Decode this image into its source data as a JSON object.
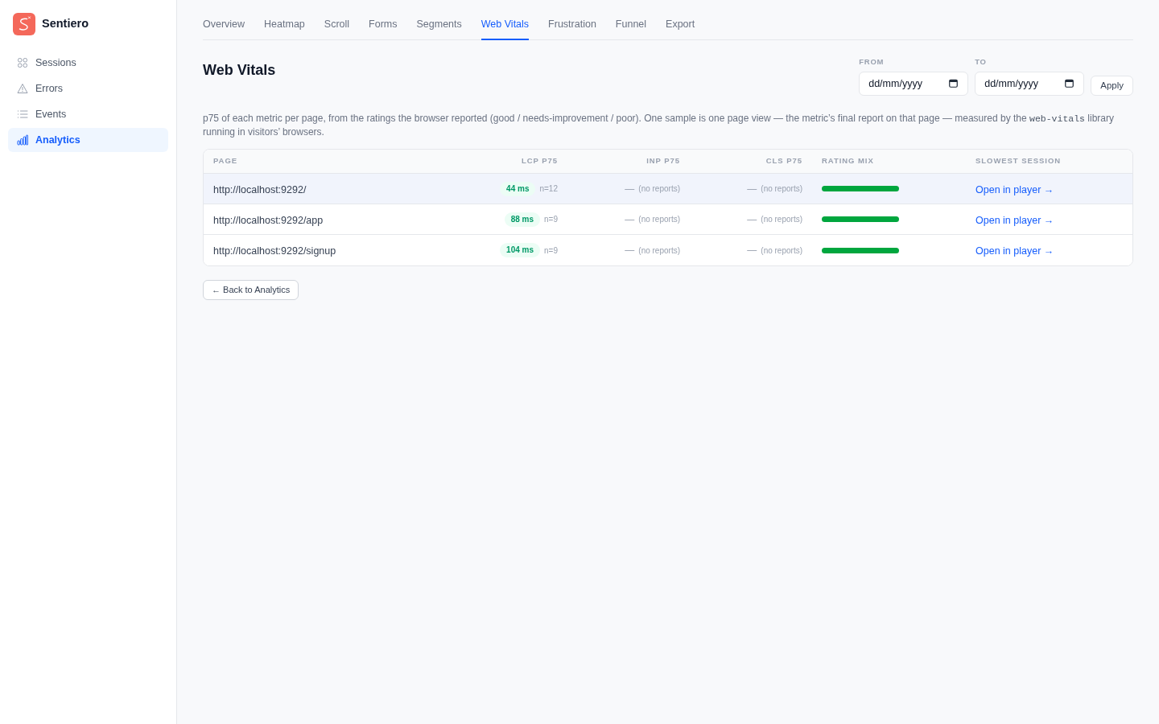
{
  "sidebar": {
    "brand": "Sentiero",
    "items": [
      {
        "label": "Sessions",
        "selected": false
      },
      {
        "label": "Errors",
        "selected": false
      },
      {
        "label": "Events",
        "selected": false
      },
      {
        "label": "Analytics",
        "selected": true
      }
    ]
  },
  "tabs": [
    {
      "label": "Overview",
      "selected": false
    },
    {
      "label": "Heatmap",
      "selected": false
    },
    {
      "label": "Scroll",
      "selected": false
    },
    {
      "label": "Forms",
      "selected": false
    },
    {
      "label": "Segments",
      "selected": false
    },
    {
      "label": "Web Vitals",
      "selected": true
    },
    {
      "label": "Frustration",
      "selected": false
    },
    {
      "label": "Funnel",
      "selected": false
    },
    {
      "label": "Export",
      "selected": false
    }
  ],
  "page": {
    "title": "Web Vitals",
    "filters": [
      {
        "label": "FROM",
        "placeholder": "dd/mm/yyyy"
      },
      {
        "label": "TO",
        "placeholder": "dd/mm/yyyy"
      }
    ],
    "apply_button": "Apply",
    "description": [
      {
        "kind": "text",
        "text": "p75 of each metric per page, from the ratings the browser reported (good / needs-improvement / poor). One sample is one page view — the metric’s final report on that page — measured by the "
      },
      {
        "kind": "code",
        "text": "web-vitals"
      },
      {
        "kind": "text",
        "text": " library running in visitors’ browsers."
      }
    ]
  },
  "table": {
    "columns": [
      "PAGE",
      "LCP P75",
      "INP P75",
      "CLS P75",
      "RATING MIX",
      "SLOWEST SESSION"
    ],
    "rows": [
      {
        "selected": true,
        "page": "http://localhost:9292/",
        "metrics": [
          {
            "kind": "good",
            "value": "44 ms",
            "samples": "n=12"
          },
          {
            "kind": "none",
            "value": "—",
            "note": "(no reports)"
          },
          {
            "kind": "none",
            "value": "—",
            "note": "(no reports)"
          }
        ],
        "rating_mix": [
          {
            "kind": "good",
            "level": 1
          }
        ],
        "session_link": "Open in player →"
      },
      {
        "selected": false,
        "page": "http://localhost:9292/app",
        "metrics": [
          {
            "kind": "good",
            "value": "88 ms",
            "samples": "n=9"
          },
          {
            "kind": "none",
            "value": "—",
            "note": "(no reports)"
          },
          {
            "kind": "none",
            "value": "—",
            "note": "(no reports)"
          }
        ],
        "rating_mix": [
          {
            "kind": "good",
            "level": 1
          }
        ],
        "session_link": "Open in player →"
      },
      {
        "selected": false,
        "page": "http://localhost:9292/signup",
        "metrics": [
          {
            "kind": "good",
            "value": "104 ms",
            "samples": "n=9"
          },
          {
            "kind": "none",
            "value": "—",
            "note": "(no reports)"
          },
          {
            "kind": "none",
            "value": "—",
            "note": "(no reports)"
          }
        ],
        "rating_mix": [
          {
            "kind": "good",
            "level": 1
          }
        ],
        "session_link": "Open in player →"
      }
    ]
  },
  "back_button": "← Back to Analytics"
}
